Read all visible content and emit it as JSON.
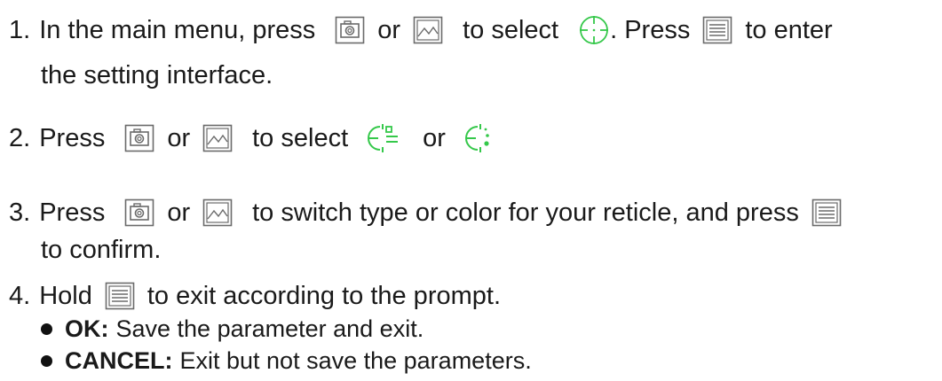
{
  "steps": [
    {
      "number": "1.",
      "p1": "In the main menu, press",
      "p2": "or",
      "p3": "to select",
      "p4": ". Press",
      "p5": "to enter",
      "cont": "the setting interface."
    },
    {
      "number": "2.",
      "p1": "Press",
      "p2": "or",
      "p3": "to select",
      "p4": "or"
    },
    {
      "number": "3.",
      "p1": "Press",
      "p2": "or",
      "p3": "to switch type or color for your reticle, and press",
      "cont": "to confirm."
    },
    {
      "number": "4.",
      "p1": "Hold",
      "p2": "to exit according to the prompt."
    }
  ],
  "bullets": [
    {
      "term": "OK:",
      "text": "Save the parameter and exit."
    },
    {
      "term": "CANCEL:",
      "text": "Exit but not save the parameters."
    }
  ],
  "icons": {
    "camera": "camera-icon",
    "gallery": "gallery-icon",
    "menu": "menu-icon",
    "reticle": "reticle-icon",
    "reticle_type": "reticle-type-icon",
    "reticle_color": "reticle-color-icon"
  },
  "colors": {
    "text": "#1a1a1a",
    "icon_gray": "#666666",
    "accent_green": "#35c84a"
  }
}
